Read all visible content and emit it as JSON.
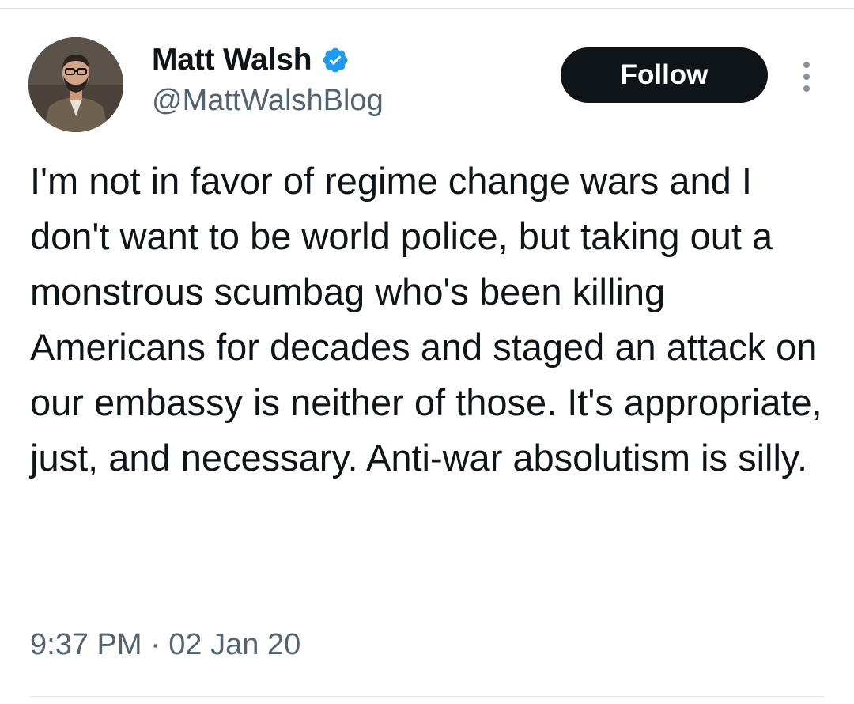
{
  "author": {
    "display_name": "Matt Walsh",
    "handle": "@MattWalshBlog",
    "verified": true,
    "verified_color": "#1d9bf0"
  },
  "actions": {
    "follow_label": "Follow",
    "more_icon": "more-vertical-icon"
  },
  "tweet": {
    "text": "I'm not in favor of regime change wars and I don't want to be world police, but taking out a monstrous scumbag who's been killing Americans for decades and staged an attack on our embassy is neither of those. It's appropriate, just, and necessary. Anti-war absolutism is silly.",
    "timestamp": "9:37 PM · 02 Jan 20"
  },
  "colors": {
    "text_primary": "#0f1419",
    "text_secondary": "#536471",
    "follow_bg": "#0f1419",
    "follow_text": "#ffffff"
  }
}
